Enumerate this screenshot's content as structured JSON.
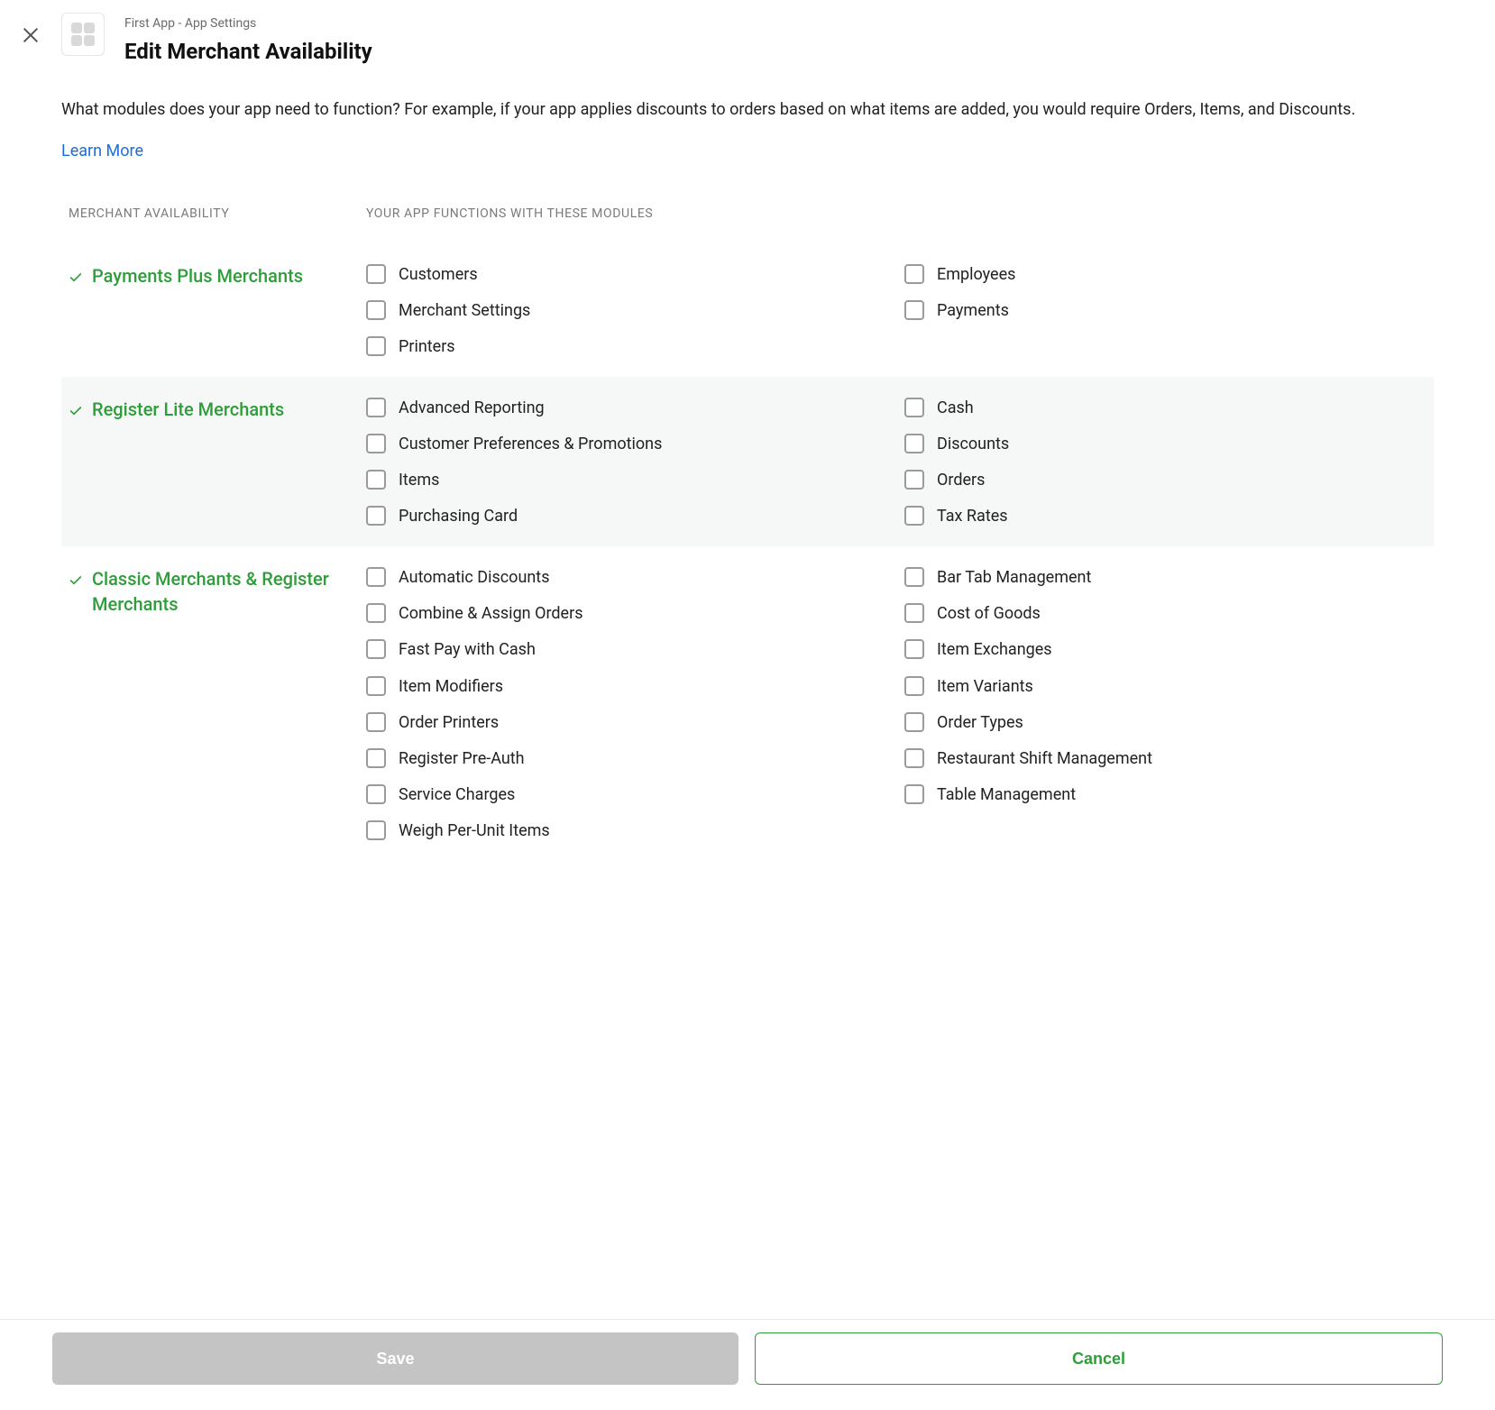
{
  "header": {
    "breadcrumb": "First App - App Settings",
    "title": "Edit Merchant Availability"
  },
  "description": "What modules does your app need to function? For example, if your app applies discounts to orders based on what items are added, you would require Orders, Items, and Discounts.",
  "learn_more": "Learn More",
  "columns": {
    "availability": "MERCHANT AVAILABILITY",
    "modules": "YOUR APP FUNCTIONS WITH THESE MODULES"
  },
  "sections": [
    {
      "title": "Payments Plus Merchants",
      "modules": [
        "Customers",
        "Employees",
        "Merchant Settings",
        "Payments",
        "Printers"
      ]
    },
    {
      "title": "Register Lite Merchants",
      "modules": [
        "Advanced Reporting",
        "Cash",
        "Customer Preferences & Promotions",
        "Discounts",
        "Items",
        "Orders",
        "Purchasing Card",
        "Tax Rates"
      ]
    },
    {
      "title": "Classic Merchants & Register Merchants",
      "modules": [
        "Automatic Discounts",
        "Bar Tab Management",
        "Combine & Assign Orders",
        "Cost of Goods",
        "Fast Pay with Cash",
        "Item Exchanges",
        "Item Modifiers",
        "Item Variants",
        "Order Printers",
        "Order Types",
        "Register Pre-Auth",
        "Restaurant Shift Management",
        "Service Charges",
        "Table Management",
        "Weigh Per-Unit Items"
      ]
    }
  ],
  "footer": {
    "save": "Save",
    "cancel": "Cancel"
  }
}
